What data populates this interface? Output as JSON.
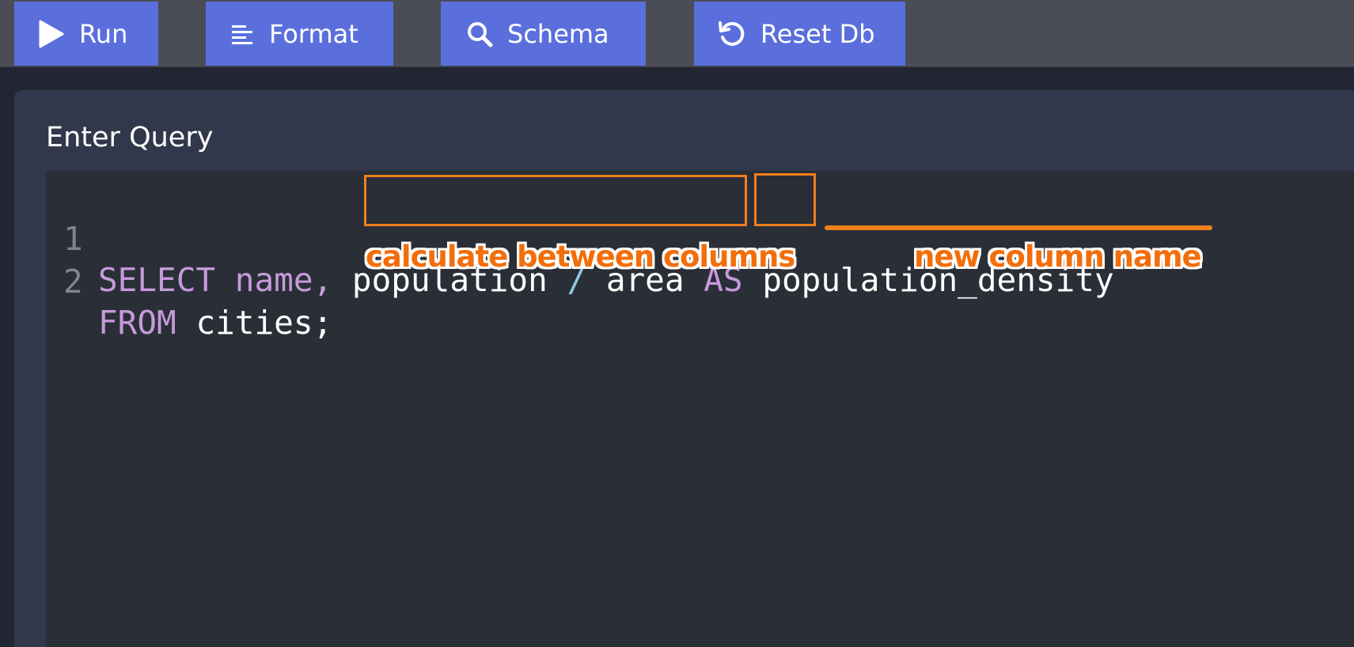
{
  "toolbar": {
    "run_label": "Run",
    "format_label": "Format",
    "schema_label": "Schema",
    "reset_label": "Reset Db"
  },
  "panel": {
    "title": "Enter Query"
  },
  "editor": {
    "lines": [
      {
        "number": "1",
        "tokens": [
          "SELECT",
          "name,",
          "population",
          "/",
          "area",
          "AS",
          "population_density"
        ]
      },
      {
        "number": "2",
        "tokens": [
          "FROM",
          "cities;"
        ]
      }
    ]
  },
  "annotations": {
    "calc": "calculate between columns",
    "alias": "new column name"
  },
  "colors": {
    "toolbar_button": "#5b6fdc",
    "keyword": "#c79adb",
    "operator": "#8ecbe8",
    "annotation": "#f26e0a"
  }
}
